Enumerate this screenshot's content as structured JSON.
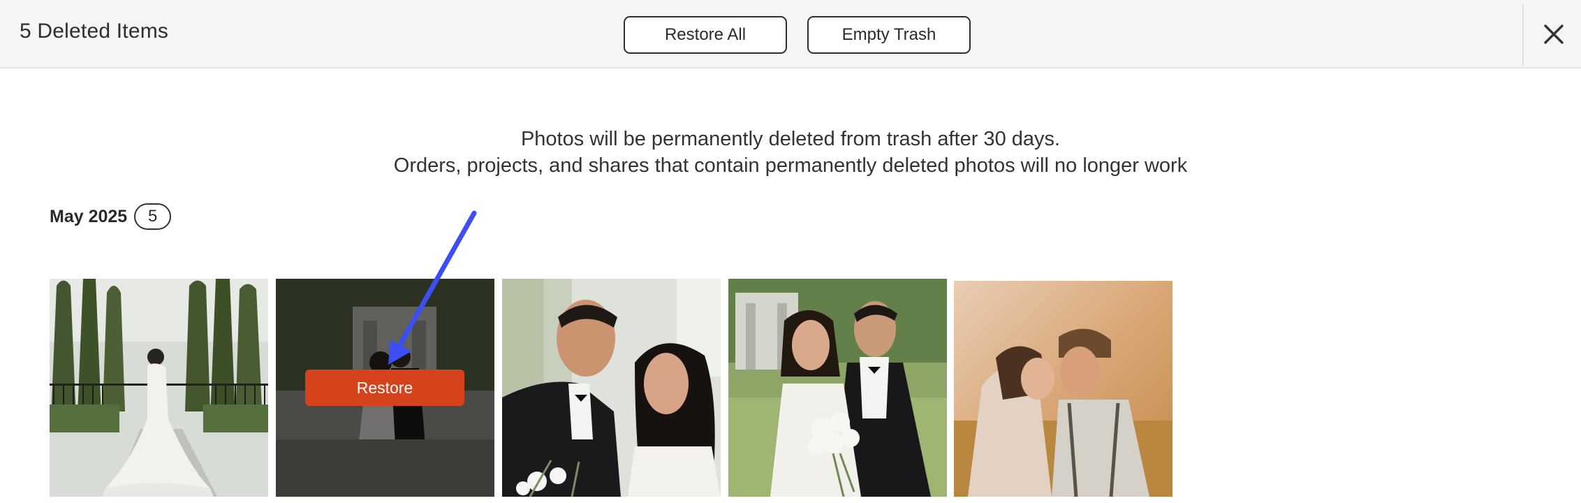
{
  "header": {
    "title": "5 Deleted Items",
    "restore_all_label": "Restore All",
    "empty_trash_label": "Empty Trash",
    "close_icon": "close-icon"
  },
  "notice": {
    "line1": "Photos will be permanently deleted from trash after 30 days.",
    "line2": "Orders, projects, and shares that contain permanently deleted photos will no longer work"
  },
  "group": {
    "label": "May 2025",
    "count": "5"
  },
  "photos": [
    {
      "description": "bride-in-cypress-garden"
    },
    {
      "description": "couple-portrait-hovered",
      "hover_action": "Restore"
    },
    {
      "description": "groom-and-bride-closeup"
    },
    {
      "description": "couple-with-bouquet-on-lawn"
    },
    {
      "description": "couple-kissing-golden-field"
    }
  ],
  "colors": {
    "restore_button": "#d4431b",
    "annotation_arrow": "#3d4ff2",
    "header_bg": "#f5f5f6"
  }
}
